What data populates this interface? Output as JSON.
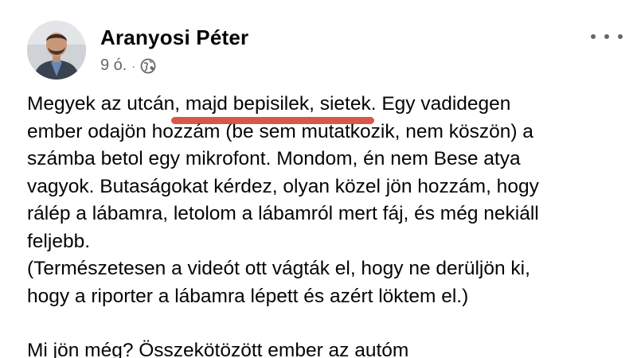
{
  "post": {
    "author": "Aranyosi Péter",
    "time": "9 ó.",
    "separator": "·",
    "icons": {
      "avatar": "avatar",
      "privacy": "globe-icon",
      "menu": "more-options-icon"
    },
    "text": {
      "line1_pre": "Megyek az utcán",
      "line1_hl": ", majd bepisilek, sietek",
      "line1_post": ". Egy vadidegen",
      "line2": "ember odajön hozzám (be sem mutatkozik, nem köszön) a",
      "line3": "számba betol egy mikrofont. Mondom, én nem Bese atya",
      "line4": "vagyok. Butaságokat kérdez, olyan közel jön hozzám, hogy",
      "line5": "rálép a lábamra, letolom a lábamról mert fáj, és még nekiáll",
      "line6": "feljebb.",
      "line7": "(Természetesen a videót ott vágták el, hogy ne derüljön ki,",
      "line8": "hogy a riporter a lábamra lépett és azért löktem el.)",
      "line9": "Mi jön még? Összekötözött ember az autóm"
    },
    "colors": {
      "text": "#050505",
      "secondary": "#65676b",
      "highlight": "#cd2814"
    }
  }
}
